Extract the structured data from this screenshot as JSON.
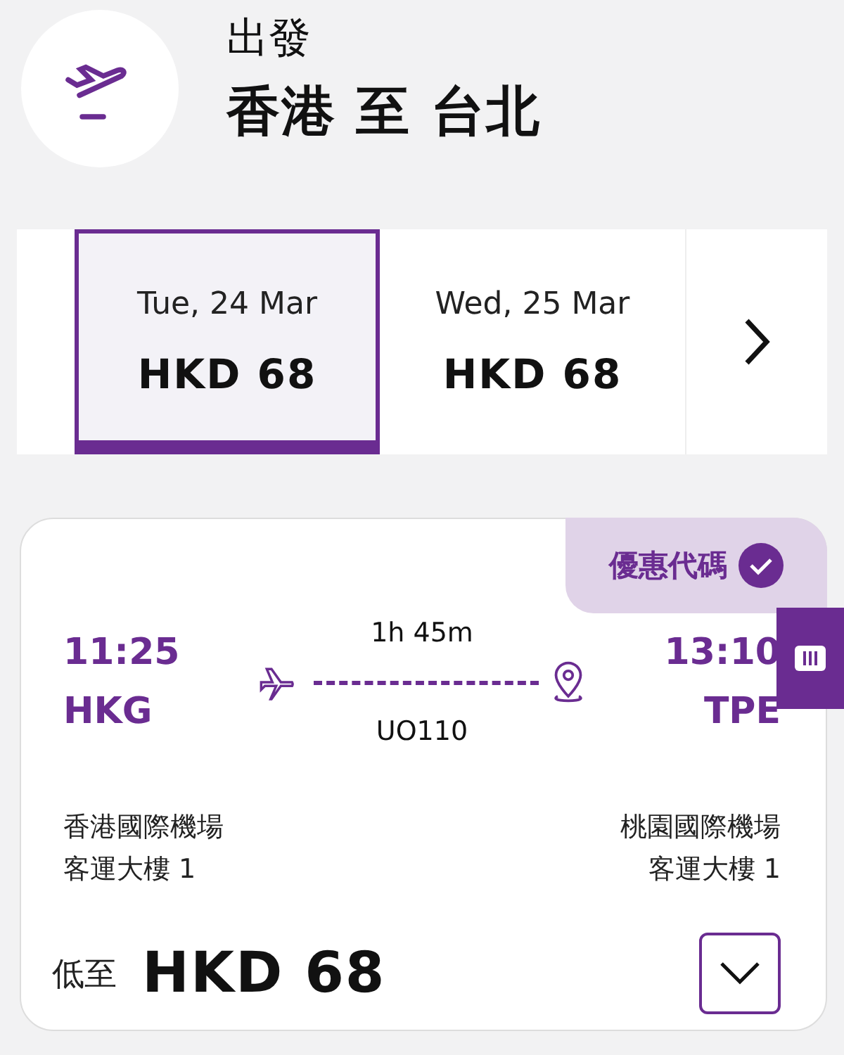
{
  "header": {
    "label": "出發",
    "route": "香港 至 台北"
  },
  "dates": [
    {
      "date": "Tue, 24 Mar",
      "price": "HKD 68",
      "selected": true
    },
    {
      "date": "Wed, 25 Mar",
      "price": "HKD 68",
      "selected": false
    }
  ],
  "flight": {
    "promo": {
      "label": "優惠代碼",
      "applied": true
    },
    "departure": {
      "time": "11:25",
      "code": "HKG",
      "airport": "香港國際機場",
      "terminal": "客運大樓 1"
    },
    "duration": "1h 45m",
    "number": "UO110",
    "arrival": {
      "time": "13:10",
      "code": "TPE",
      "airport": "桃園國際機場",
      "terminal": "客運大樓 1"
    },
    "price_prefix": "低至",
    "price": "HKD 68",
    "expanded": false
  }
}
